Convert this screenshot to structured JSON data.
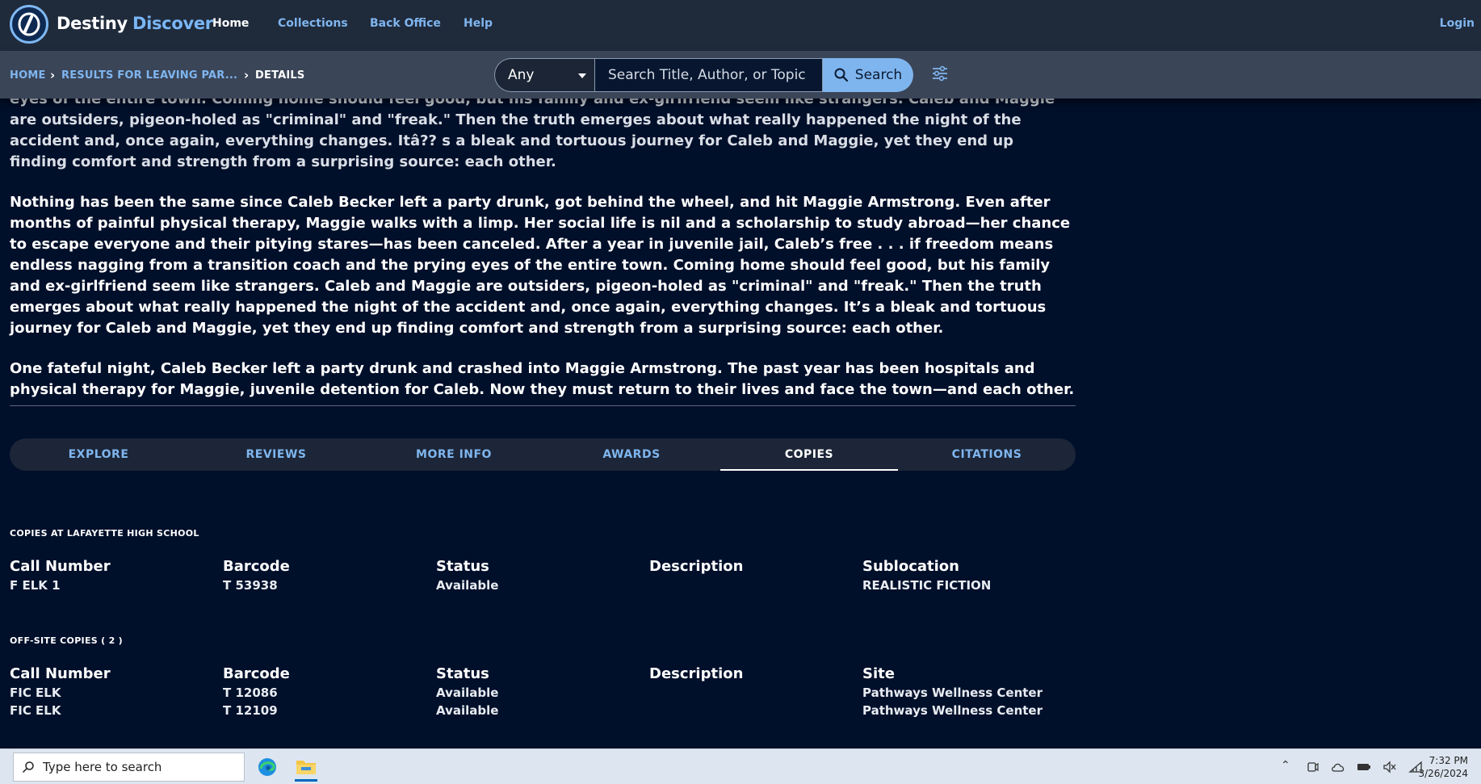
{
  "nav": {
    "brand_main": "Destiny",
    "brand_accent": "Discover",
    "links": [
      "Home",
      "Collections",
      "Back Office",
      "Help"
    ],
    "login": "Login"
  },
  "breadcrumb": {
    "home": "HOME",
    "results": "RESULTS FOR LEAVING PAR...",
    "current": "DETAILS"
  },
  "search": {
    "scope": "Any",
    "placeholder": "Search Title, Author, or Topic",
    "button": "Search"
  },
  "summary": {
    "para1": "eyes of the entire town. Coming home should feel good, but his family and ex-girlfriend seem like strangers. Caleb and Maggie are outsiders, pigeon-holed as \"criminal\" and \"freak.\" Then the truth emerges about what really happened the night of the accident and, once again, everything changes. Itâ?? s a bleak and tortuous journey for Caleb and Maggie, yet they end up finding comfort and strength from a surprising source: each other.",
    "para2": "Nothing has been the same since Caleb Becker left a party drunk, got behind the wheel, and hit Maggie Armstrong. Even after months of painful physical therapy, Maggie walks with a limp. Her social life is nil and a scholarship to study abroad—her chance to escape everyone and their pitying stares—has been canceled. After a year in juvenile jail, Caleb’s free . . . if freedom means endless nagging from a transition coach and the prying eyes of the entire town. Coming home should feel good, but his family and ex-girlfriend seem like strangers. Caleb and Maggie are outsiders, pigeon-holed as \"criminal\" and \"freak.\" Then the truth emerges about what really happened the night of the accident and, once again, everything changes. It’s a bleak and tortuous journey for Caleb and Maggie, yet they end up finding comfort and strength from a surprising source: each other.",
    "para3": "One fateful night, Caleb Becker left a party drunk and crashed into Maggie Armstrong. The past year has been hospitals and physical therapy for Maggie, juvenile detention for Caleb. Now they must return to their lives and face the town—and each other."
  },
  "tabs": [
    "EXPLORE",
    "REVIEWS",
    "MORE INFO",
    "AWARDS",
    "COPIES",
    "CITATIONS"
  ],
  "active_tab": "COPIES",
  "local_copies": {
    "heading": "COPIES AT LAFAYETTE HIGH SCHOOL",
    "columns": [
      "Call Number",
      "Barcode",
      "Status",
      "Description",
      "Sublocation"
    ],
    "rows": [
      [
        "F ELK 1",
        "T 53938",
        "Available",
        "",
        "REALISTIC FICTION"
      ]
    ]
  },
  "offsite_copies": {
    "heading": "OFF-SITE COPIES ( 2 )",
    "columns": [
      "Call Number",
      "Barcode",
      "Status",
      "Description",
      "Site"
    ],
    "rows": [
      [
        "FIC ELK",
        "T 12086",
        "Available",
        "",
        "Pathways Wellness Center"
      ],
      [
        "FIC ELK",
        "T 12109",
        "Available",
        "",
        "Pathways Wellness Center"
      ]
    ]
  },
  "taskbar": {
    "search_placeholder": "Type here to search",
    "time": "7:32 PM",
    "date": "3/26/2024"
  },
  "colors": {
    "background": "#000f2a",
    "nav_bg": "#1f2a3b",
    "accent": "#7fb5ee"
  }
}
